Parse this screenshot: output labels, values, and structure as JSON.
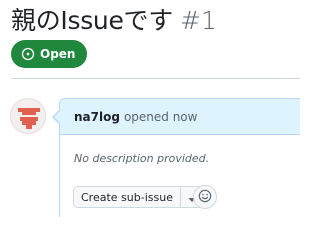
{
  "issue": {
    "title": "親のIssueです",
    "number": "#1",
    "state": "Open"
  },
  "comment": {
    "author": "na7log",
    "action": "opened now",
    "body": "No description provided.",
    "sub_issue_button": "Create sub-issue"
  },
  "icons": {
    "state": "issue-opened-icon",
    "avatar": "identicon-avatar",
    "dropdown": "triangle-down-icon",
    "reaction": "smiley-icon"
  },
  "colors": {
    "open_badge": "#1f883d",
    "comment_header_bg": "#ddf4ff",
    "comment_border": "#b6d7ff",
    "avatar_glyph": "#e0614f"
  }
}
